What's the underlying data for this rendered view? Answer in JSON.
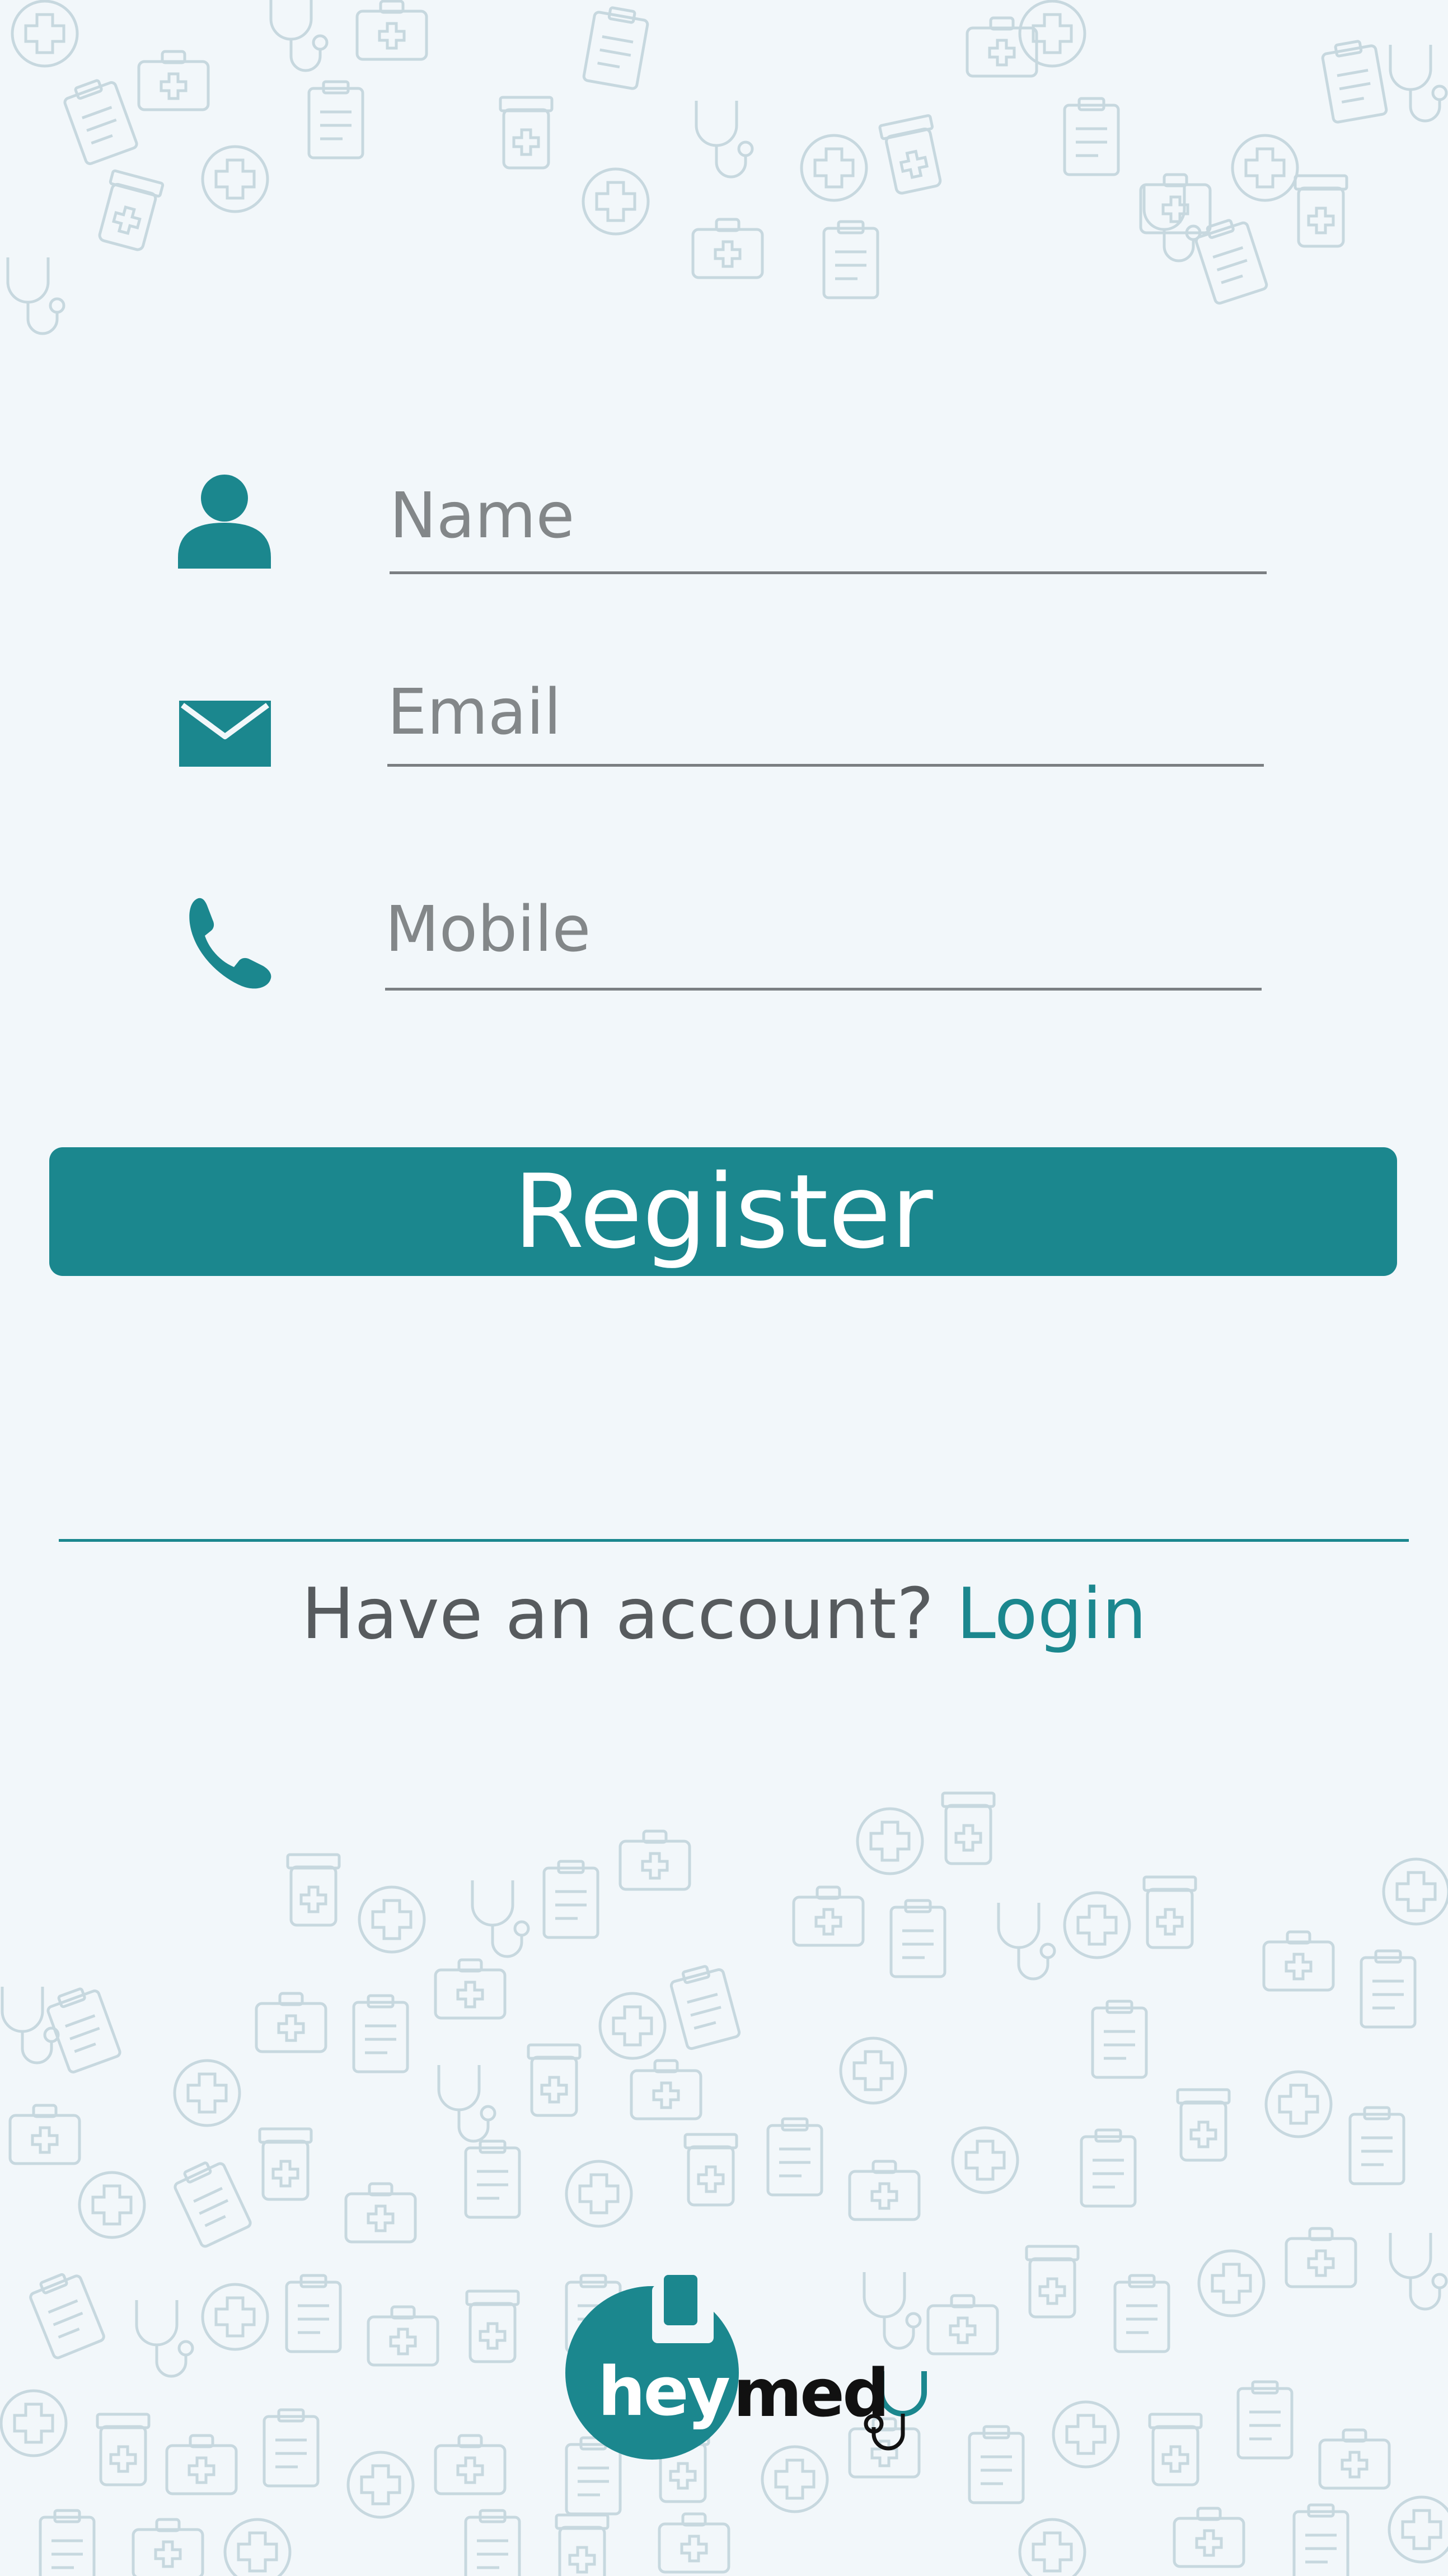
{
  "form": {
    "name_placeholder": "Name",
    "email_placeholder": "Email",
    "mobile_placeholder": "Mobile",
    "icons": {
      "name": "person-icon",
      "email": "envelope-icon",
      "mobile": "phone-icon"
    }
  },
  "actions": {
    "register_label": "Register"
  },
  "footer": {
    "account_prompt": "Have an account?",
    "login_label": "Login"
  },
  "logo": {
    "word_left": "hey",
    "word_right": "med"
  },
  "colors": {
    "accent": "#1b878e",
    "background": "#f2f7fa",
    "text": "#575b5e",
    "pattern": "#c7d8df"
  }
}
